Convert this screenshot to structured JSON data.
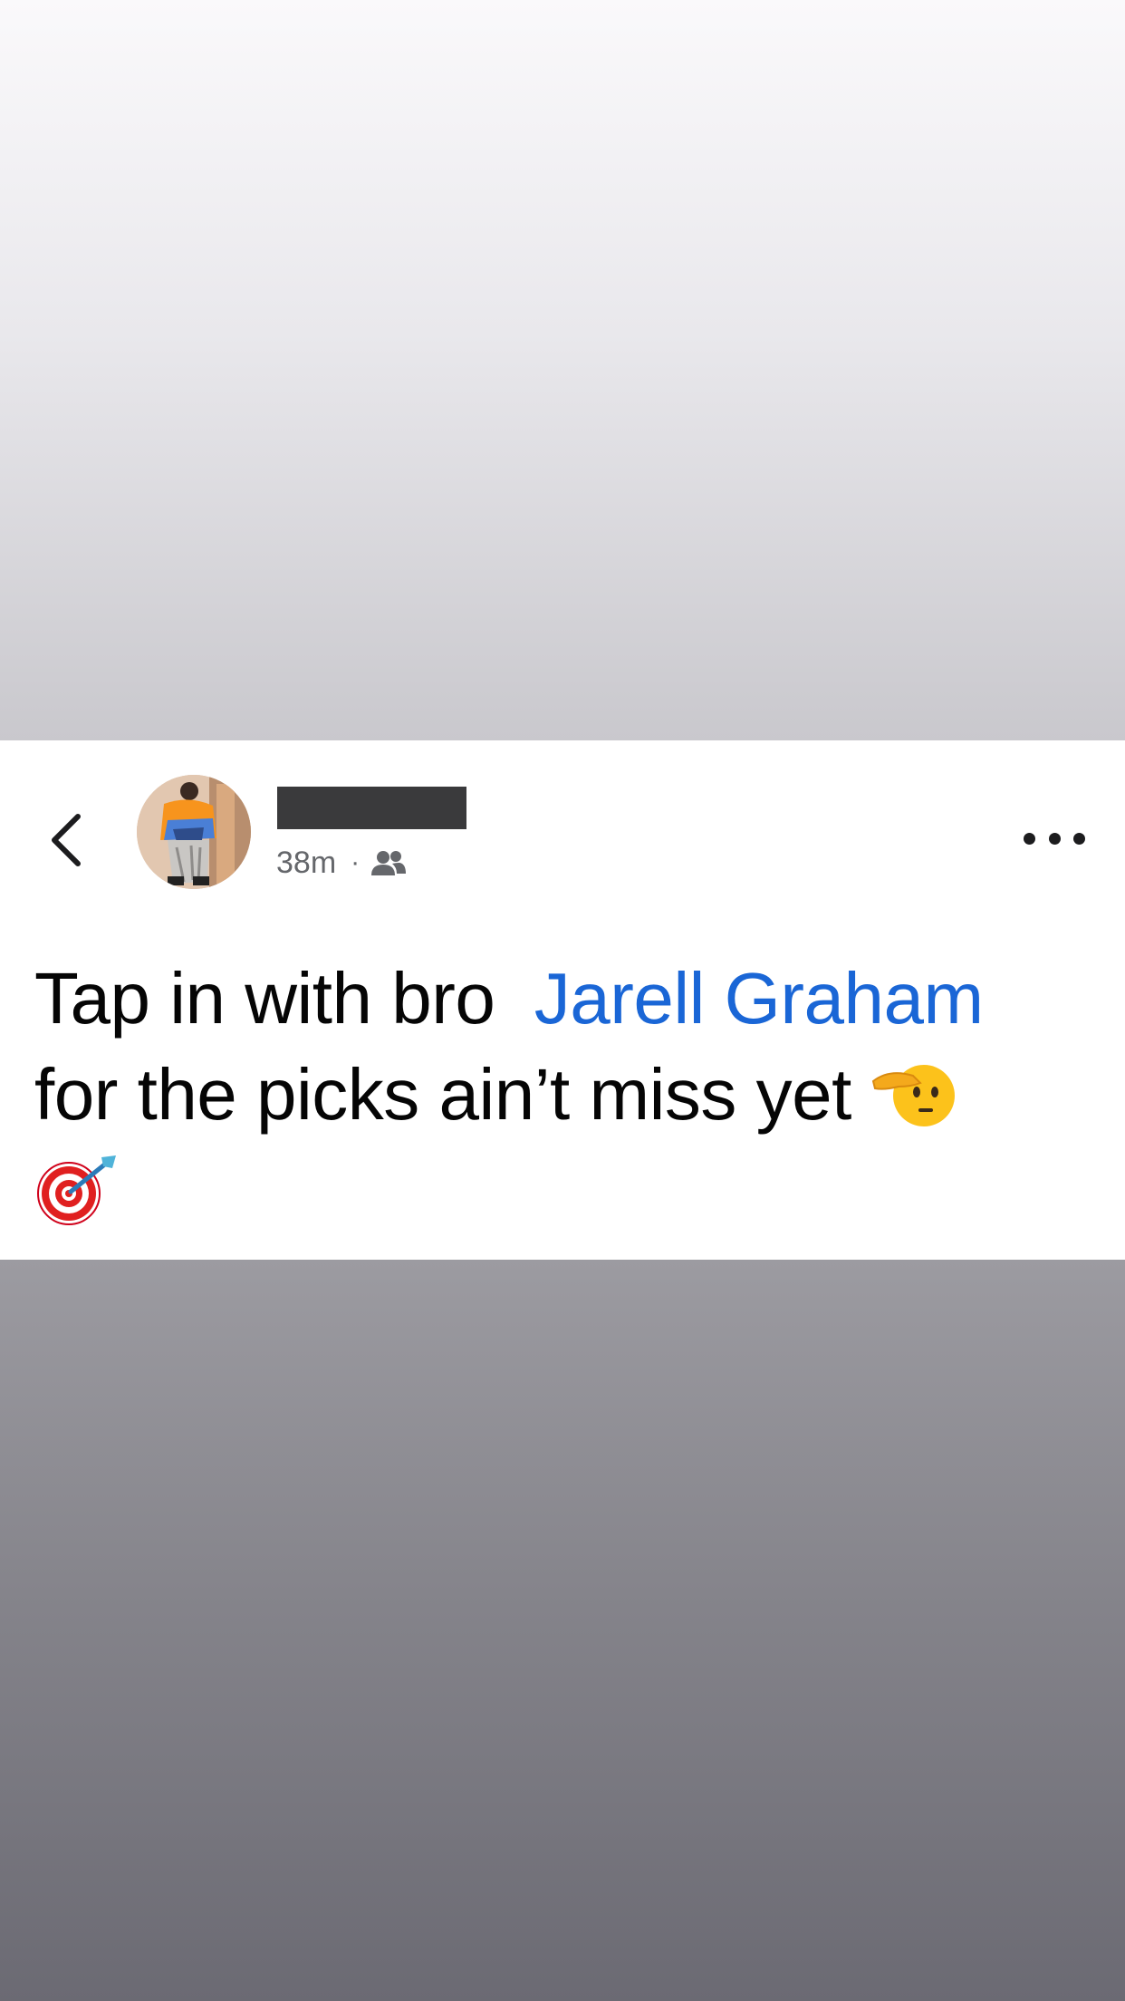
{
  "post": {
    "timestamp": "38m",
    "separator": "·",
    "audience_icon": "friends-icon",
    "text_before_mention": "Tap in with bro",
    "mention": "Jarell Graham",
    "text_line2": "for the picks ain’t miss yet",
    "emoji_1": "saluting-face-emoji",
    "emoji_2": "direct-hit-emoji"
  },
  "header": {
    "back_icon": "chevron-left-icon",
    "more_icon": "more-horizontal-icon"
  },
  "colors": {
    "mention": "#1a66d6",
    "text": "#050505",
    "meta": "#65676b"
  }
}
